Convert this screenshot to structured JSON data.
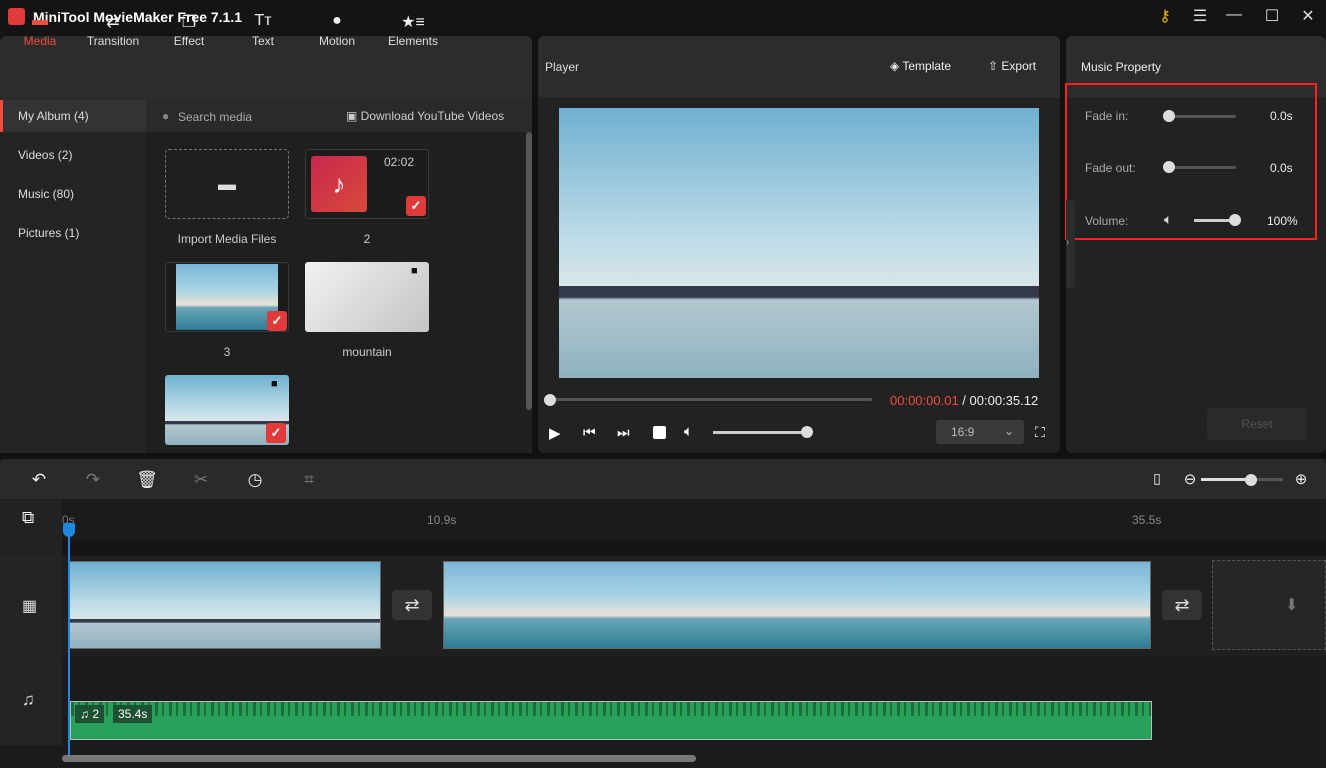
{
  "app": {
    "title": "MiniTool MovieMaker Free 7.1.1"
  },
  "window_controls": [
    "key-icon",
    "menu-icon",
    "minimize-icon",
    "maximize-icon",
    "close-icon"
  ],
  "nav": {
    "items": [
      {
        "label": "Media",
        "icon": "folder-icon",
        "active": true
      },
      {
        "label": "Transition",
        "icon": "swap-icon"
      },
      {
        "label": "Effect",
        "icon": "layers-icon"
      },
      {
        "label": "Text",
        "icon": "text-icon"
      },
      {
        "label": "Motion",
        "icon": "motion-icon"
      },
      {
        "label": "Elements",
        "icon": "star-list-icon"
      }
    ]
  },
  "sidebar": {
    "items": [
      {
        "label": "My Album (4)",
        "active": true
      },
      {
        "label": "Videos (2)"
      },
      {
        "label": "Music (80)"
      },
      {
        "label": "Pictures (1)"
      }
    ]
  },
  "media": {
    "search_placeholder": "Search media",
    "download_label": "Download YouTube Videos",
    "items": [
      {
        "caption": "Import Media Files"
      },
      {
        "caption": "2",
        "duration": "02:02",
        "checked": true
      },
      {
        "caption": "3",
        "checked": true
      },
      {
        "caption": "mountain"
      },
      {
        "caption": "",
        "checked": true
      }
    ]
  },
  "player": {
    "title": "Player",
    "template_label": "Template",
    "export_label": "Export",
    "current_time": "00:00:00.01",
    "separator": " / ",
    "total_time": "00:00:35.12",
    "progress": 0,
    "volume": 100,
    "aspect": "16:9"
  },
  "music_property": {
    "title": "Music Property",
    "fade_in_label": "Fade in:",
    "fade_in_value": "0.0s",
    "fade_out_label": "Fade out:",
    "fade_out_value": "0.0s",
    "volume_label": "Volume:",
    "volume_value": "100%",
    "reset_label": "Reset",
    "highlight_color": "#ff2020"
  },
  "timeline": {
    "ruler": [
      "0s",
      "10.9s",
      "35.5s"
    ],
    "audio_clip": {
      "name": "2",
      "duration": "35.4s",
      "color": "#27a05a"
    }
  },
  "colors": {
    "accent": "#f04c40",
    "playhead": "#1e88e5"
  }
}
